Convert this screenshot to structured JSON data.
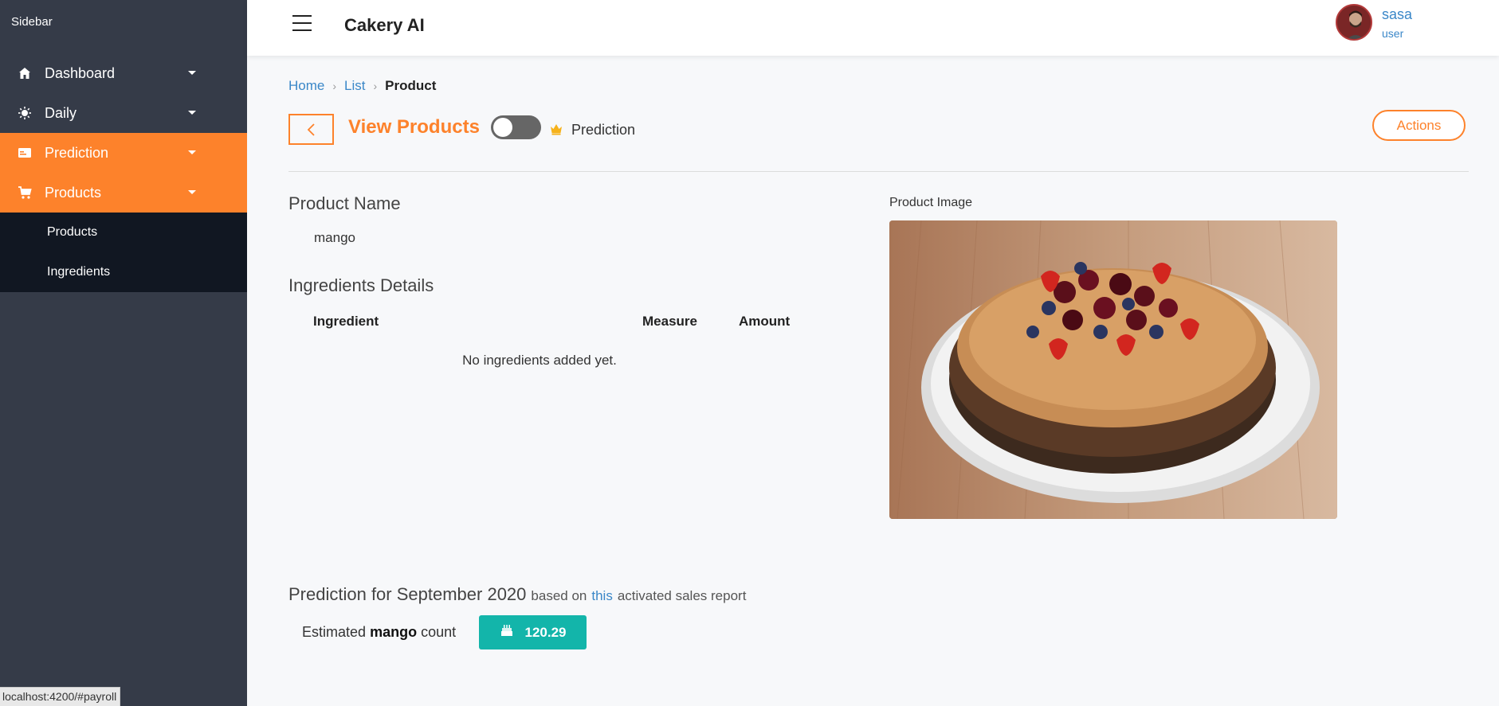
{
  "sidebar": {
    "title": "Sidebar",
    "items": [
      {
        "label": "Dashboard",
        "icon": "home-icon"
      },
      {
        "label": "Daily",
        "icon": "sun-icon"
      },
      {
        "label": "Prediction",
        "icon": "card-icon"
      },
      {
        "label": "Products",
        "icon": "cart-icon"
      }
    ],
    "submenu": [
      {
        "label": "Products"
      },
      {
        "label": "Ingredients"
      }
    ],
    "status_url": "localhost:4200/#payroll"
  },
  "header": {
    "app_title": "Cakery AI",
    "user_name": "sasa",
    "user_role": "user"
  },
  "breadcrumb": {
    "home": "Home",
    "list": "List",
    "current": "Product"
  },
  "page": {
    "title": "View Products",
    "toggle_label": "Prediction",
    "toggle_on": false,
    "actions_label": "Actions"
  },
  "product": {
    "name_heading": "Product Name",
    "name": "mango",
    "ingredients_heading": "Ingredients Details",
    "columns": [
      "Ingredient",
      "Measure",
      "Amount"
    ],
    "empty_message": "No ingredients added yet.",
    "image_label": "Product Image"
  },
  "prediction": {
    "title": "Prediction for September 2020",
    "based_on": "based on",
    "link": "this",
    "suffix": "activated sales report",
    "est_prefix": "Estimated",
    "est_item": "mango",
    "est_suffix": "count",
    "value": "120.29"
  },
  "colors": {
    "accent": "#fd822b",
    "sidebar": "#353b48",
    "submenu": "#111722",
    "badge": "#13b5aa",
    "link": "#3a87c8"
  }
}
